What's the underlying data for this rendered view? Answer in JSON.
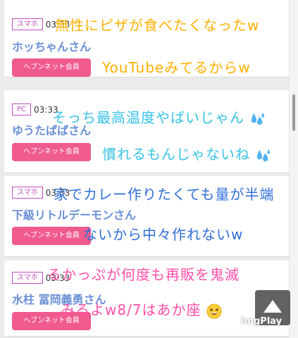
{
  "posts": [
    {
      "device": "スマホ",
      "time": "03:33",
      "username": "ホッちゃんさん",
      "badge": "ヘブンネット会員",
      "overlay_lines": [
        "無性にピザが食べたくなったw",
        "YouTubeみてるからw"
      ]
    },
    {
      "device": "PC",
      "time": "03:33",
      "username": "ゆうたぱぱさん",
      "badge": "ヘブンネット会員",
      "overlay_lines": [
        "そっち最高温度やばいじゃん",
        "慣れるもんじゃないね"
      ]
    },
    {
      "device": "スマホ",
      "time": "03:33",
      "username": "下級リトルデーモンさん",
      "badge": "ヘブンネット会員",
      "overlay_lines": [
        "家でカレー作りたくても量が半端",
        "ないから中々作れないw"
      ]
    },
    {
      "device": "スマホ",
      "time": "03:33",
      "username": "水柱 冨岡義勇さん",
      "badge": "ヘブンネット会員",
      "overlay_lines": [
        "るかっぷが何度も再販を鬼滅",
        "みるよw8/7はあか座"
      ]
    }
  ],
  "icons": {
    "sweat": "sweat-droplets-icon",
    "grin": "grinning-squinting-face-icon",
    "scroll_top": "chevron-up-icon"
  },
  "watermark": "imgPlay",
  "colors": {
    "device_tag": "#c04bc3",
    "username": "#6a8fd6",
    "badge": "#f05b8f",
    "overlay_orange": "#ffb000",
    "overlay_cyan": "#38c2e8",
    "overlay_blue": "#2e6fd8",
    "overlay_pink": "#ff4fa8"
  }
}
